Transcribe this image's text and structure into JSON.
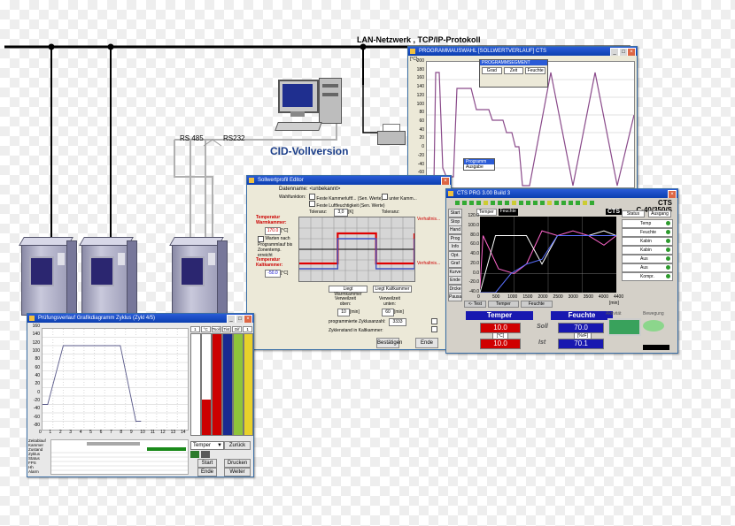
{
  "network": {
    "lan_label": "LAN-Netzwerk , TCP/IP-Protokoll",
    "rs485_label": "RS 485",
    "rs232_label": "RS232",
    "cid_label": "CID-Vollversion"
  },
  "colors": {
    "lan_line": "#000000",
    "cid_text": "#1c3f8a",
    "serial_line": "#b0b0b0",
    "chamber_door": "#2b2670",
    "title_bar": "#1a4fcc"
  },
  "icons": [
    "computer-workstation-icon",
    "printer-icon",
    "climate-chamber-icon"
  ],
  "win_profile": {
    "title": "Sollwertprofil Editor",
    "header_text": "Datenname: <unbekannt>",
    "row_label": "Wahlfunktion:",
    "opt1": "Feste Kammerluftf... (Sen. Werte)",
    "opt2": "Feste Luftfeuchtigkeit (Sen. Werte)",
    "opt_right": "unter Kamm...",
    "toleranz_label": "Toleranz:",
    "toleranz_value": "3,0",
    "toleranz_unit": "[K]",
    "toleranz2": "Toleranz:",
    "temp_warm_label": "Temperatur Warmkammer:",
    "temp_warm_value": "170.0",
    "temp_warm_unit": "[°C]",
    "checkbox_text": "Warten nach Programmlauf bis Zonentemp. erreicht",
    "temp_kalt_label": "Temperatur Kaltkammer:",
    "temp_kalt_value": "-50.0",
    "temp_kalt_unit": "[°C]",
    "right_labels": [
      "Verhaltnis...",
      "Verhaltnis..."
    ],
    "legend_top": "Liegt Warmkammer",
    "legend_bottom": "Liegt Kaltkammer",
    "verw_oben_label": "Verweilzeit oben:",
    "verw_oben_value": "10",
    "verw_unten_label": "Verweilzeit unten:",
    "verw_unten_value": "60",
    "min_unit": "[min]",
    "programm_label": "programmierte Zyklusanzahl:",
    "programm_value": "3333",
    "zyklen_label": "Zyklenstand in Kaltkammer:",
    "btn_ok": "Bestätigen",
    "btn_cancel": "Ende"
  },
  "win_top": {
    "title": "PROGRAMMAUSWAHL  [SOLLWERTVERLAUF]  CTS",
    "popup_title": "PROGRAMMSEGMENT",
    "popup_row": [
      "Grad",
      "Zeit",
      "Feuchte"
    ],
    "y_unit": "[°C]",
    "y_ticks": [
      "200",
      "180",
      "160",
      "140",
      "120",
      "100",
      "80",
      "60",
      "40",
      "20",
      "0",
      "-20",
      "-40",
      "-60",
      "-80"
    ],
    "menu_items": [
      "Programm",
      "Ausgabe"
    ]
  },
  "win_cts": {
    "title": "CTS PRG 3.00 Build 3",
    "brand": "CTS",
    "model_label": "C-40/350/S",
    "badge": "CTS",
    "tabs": [
      "Temper",
      "Feuchte"
    ],
    "side_buttons": [
      "Start",
      "Stop",
      "Hand",
      "Prog",
      "Info",
      "Opt.",
      "Graf",
      "Kurve",
      "Ende",
      "Drcke",
      "Pausa"
    ],
    "y_ticks": [
      "120.0",
      "100.0",
      "80.0",
      "60.0",
      "40.0",
      "20.0",
      "0.0",
      "-20.0",
      "-40.0"
    ],
    "x_ticks": [
      "0",
      "500",
      "1000",
      "1500",
      "2000",
      "2500",
      "3000",
      "3500",
      "4000",
      "4400"
    ],
    "x_unit": "[min]",
    "bottom_tabs": [
      "<- Test",
      "Temper",
      "Feuchte"
    ],
    "panel_left_title": "Temper",
    "panel_right_title": "Feuchte",
    "soll_label": "Soll",
    "ist_label": "Ist",
    "temp_soll": "10.0",
    "temp_ist": "10.0",
    "temp_unit": "[°C]",
    "feuchte_soll": "70.0",
    "feuchte_ist": "70.1",
    "feuchte_unit": "[%rF]",
    "right_list": [
      "Temp",
      "Feuchte",
      "Kabin",
      "Kabin",
      "Aus",
      "Aus",
      "Kompr."
    ],
    "right_top": [
      "Status",
      "Ausgang"
    ],
    "green_block_label": "Aktivität",
    "oval_label": "Bewegung"
  },
  "win_prog": {
    "title": "Prüfungsverlauf  Grafikdiagramm  Zyklus  (Zykl 4/5)",
    "y_ticks": [
      "160",
      "140",
      "120",
      "100",
      "80",
      "60",
      "40",
      "20",
      "0",
      "-20",
      "-40",
      "-60",
      "-80"
    ],
    "x_ticks": [
      "0",
      "1",
      "2",
      "3",
      "4",
      "5",
      "6",
      "7",
      "8",
      "9",
      "10",
      "11",
      "12",
      "13",
      "14"
    ],
    "row_labels": [
      "Zeitablauf",
      "Kammer",
      "Zustand",
      "Zyklus",
      "Status",
      "FPS",
      "Hh",
      "Alarm"
    ],
    "col_headers": [
      "1",
      "°C",
      "Tsoll",
      "Tist",
      "Dif",
      "1"
    ],
    "combo_value": "Temper",
    "btn_labels": [
      "Zurück",
      "Start",
      "Drucken",
      "Ende",
      "Weiter"
    ]
  },
  "chart_data": [
    {
      "type": "line",
      "title": "",
      "description_source": "profile editor cycle diagram",
      "series": [
        {
          "color": "#e00000",
          "values": [
            -50,
            -50,
            170,
            170,
            -50,
            -50,
            170
          ]
        },
        {
          "color": "#4050c0",
          "values": [
            -50,
            -50,
            170,
            170,
            -50,
            -50,
            170
          ]
        }
      ],
      "grid": true
    },
    {
      "type": "line",
      "xlabel": "[min]",
      "ylim": [
        -40,
        120
      ],
      "xlim": [
        0,
        4400
      ],
      "series": [
        {
          "color": "#ff66cc",
          "x": [
            0,
            100,
            600,
            1100,
            1500,
            2000,
            2500,
            3000,
            3500,
            4000,
            4400
          ],
          "values": [
            -30,
            80,
            10,
            0,
            20,
            90,
            80,
            90,
            80,
            60,
            80
          ]
        },
        {
          "color": "#ffffff",
          "x": [
            0,
            500,
            1000,
            1500,
            2000,
            2500,
            3000,
            3500,
            4000,
            4400
          ],
          "values": [
            -40,
            80,
            80,
            80,
            20,
            80,
            80,
            80,
            90,
            80
          ]
        },
        {
          "color": "#5a70ff",
          "x": [
            0,
            500,
            1000,
            1500,
            2000,
            2500,
            3000,
            4400
          ],
          "values": [
            -40,
            -40,
            0,
            20,
            30,
            80,
            80,
            80
          ]
        }
      ],
      "grid": true
    },
    {
      "type": "line",
      "ylim": [
        -80,
        160
      ],
      "xlim": [
        0,
        14
      ],
      "series": [
        {
          "color": "#5a5a8a",
          "x": [
            0,
            0.5,
            2,
            7.5,
            9,
            9.5
          ],
          "values": [
            -20,
            -20,
            120,
            120,
            -60,
            -60
          ]
        }
      ],
      "grid": true
    }
  ]
}
